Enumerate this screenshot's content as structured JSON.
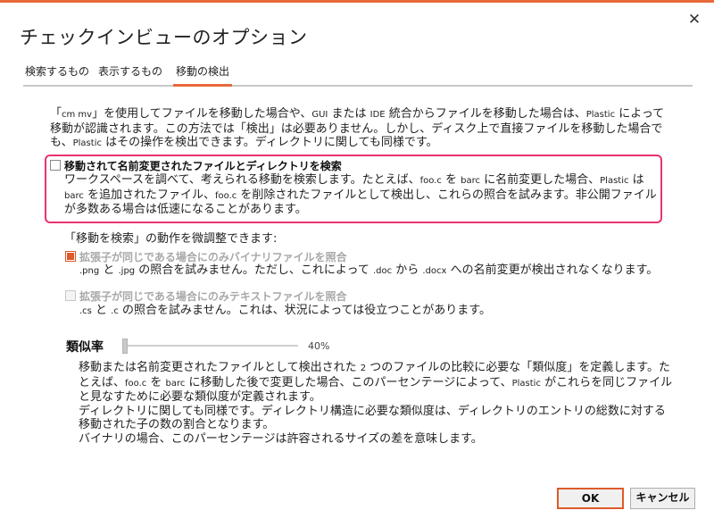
{
  "window": {
    "title": "チェックインビューのオプション",
    "close_glyph": "✕"
  },
  "tabs": [
    {
      "label": "検索するもの"
    },
    {
      "label": "表示するもの"
    },
    {
      "label": "移動の検出"
    }
  ],
  "intro": {
    "line1_a": "「",
    "cmd": "cm mv",
    "line1_b": "」を使用してファイルを移動した場合や、",
    "gui": "GUI",
    "line1_c": " または ",
    "ide": "IDE",
    "line1_d": " 統合からファイルを移動した場合は、",
    "plastic": "Plastic",
    "line1_e": " によって移動が認識されます。この方法では「検出」は必要ありません。しかし、ディスク上で直接ファイルを移動した場合でも、",
    "plastic2": "Plastic",
    "line1_f": " はその操作を検出できます。ディレクトリに関しても同様です。"
  },
  "detect_moves": {
    "label": "移動されて名前変更されたファイルとディレクトリを検索",
    "desc_a": "ワークスペースを調べて、考えられる移動を検索します。たとえば、",
    "fooc": "foo.c",
    "desc_b": " を ",
    "barc": "barc",
    "desc_c": " に名前変更した場合、",
    "plastic": "Plastic",
    "desc_d": " は ",
    "barc2": "barc",
    "desc_e": " を追加されたファイル、",
    "fooc2": "foo.c",
    "desc_f": " を削除されたファイルとして検出し、これらの照合を試みます。非公開ファイルが多数ある場合は低速になることがあります。"
  },
  "fine_tune": "「移動を検索」の動作を微調整できます:",
  "binary_option": {
    "label": "拡張子が同じである場合にのみバイナリファイルを照合",
    "ext1": ".png",
    "t1": " と ",
    "ext2": ".jpg",
    "t2": " の照合を試みません。ただし、これによって ",
    "ext3": ".doc",
    "t3": " から ",
    "ext4": ".docx",
    "t4": " への名前変更が検出されなくなります。"
  },
  "text_option": {
    "label": "拡張子が同じである場合にのみテキストファイルを照合",
    "ext1": ".cs",
    "t1": " と ",
    "ext2": ".c",
    "t2": " の照合を試みません。これは、状況によっては役立つことがあります。"
  },
  "similarity": {
    "label": "類似率",
    "value_text": "40%",
    "value": 0.4,
    "desc_a": "移動または名前変更されたファイルとして検出された ",
    "two": "2",
    "desc_b": " つのファイルの比較に必要な「類似度」を定義します。たとえば、",
    "fooc": "foo.c",
    "desc_c": " を ",
    "barc": "barc",
    "desc_d": " に移動した後で変更した場合、このパーセンテージによって、",
    "plastic": "Plastic",
    "desc_e": " がこれらを同じファイルと見なすために必要な類似度が定義されます。",
    "line2": "ディレクトリに関しても同様です。ディレクトリ構造に必要な類似度は、ディレクトリのエントリの総数に対する移動された子の数の割合となります。",
    "line3": "バイナリの場合、このパーセンテージは許容されるサイズの差を意味します。"
  },
  "buttons": {
    "ok": "OK",
    "cancel": "キャンセル"
  },
  "colors": {
    "accent": "#e86a3a",
    "highlight": "#e8336e"
  }
}
